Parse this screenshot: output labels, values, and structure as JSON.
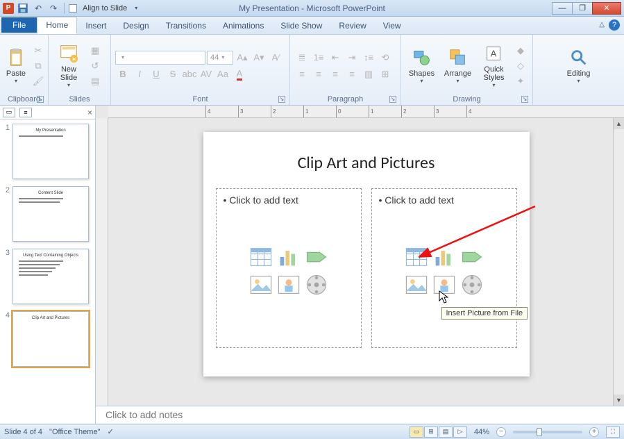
{
  "titlebar": {
    "app_letter": "P",
    "align_label": "Align to Slide",
    "title": "My Presentation - Microsoft PowerPoint"
  },
  "tabs": {
    "file": "File",
    "items": [
      "Home",
      "Insert",
      "Design",
      "Transitions",
      "Animations",
      "Slide Show",
      "Review",
      "View"
    ],
    "active_index": 0
  },
  "ribbon": {
    "clipboard": {
      "label": "Clipboard",
      "paste": "Paste"
    },
    "slides": {
      "label": "Slides",
      "new_slide": "New\nSlide"
    },
    "font": {
      "label": "Font",
      "font_name": "",
      "font_size": "44"
    },
    "paragraph": {
      "label": "Paragraph"
    },
    "drawing": {
      "label": "Drawing",
      "shapes": "Shapes",
      "arrange": "Arrange",
      "quick_styles": "Quick\nStyles"
    },
    "editing": {
      "label": "Editing",
      "editing_btn": "Editing"
    }
  },
  "thumbnails": {
    "slides": [
      {
        "num": "1",
        "title": "My Presentation",
        "lines": 1
      },
      {
        "num": "2",
        "title": "Content Slide",
        "lines": 2
      },
      {
        "num": "3",
        "title": "Using Text Containing Objects",
        "lines": 5
      },
      {
        "num": "4",
        "title": "Clip Art and Pictures",
        "lines": 0
      }
    ],
    "selected": 3
  },
  "ruler_ticks": [
    "4",
    "3",
    "2",
    "1",
    "0",
    "1",
    "2",
    "3",
    "4"
  ],
  "slide": {
    "title": "Clip Art and Pictures",
    "placeholder_text": "Click to add text",
    "tooltip": "Insert Picture from File",
    "content_icons": [
      "table",
      "chart",
      "smartart",
      "picture",
      "clipart",
      "media"
    ]
  },
  "notes": {
    "prompt": "Click to add notes"
  },
  "statusbar": {
    "slide_info": "Slide 4 of 4",
    "theme": "\"Office Theme\"",
    "zoom": "44%"
  }
}
